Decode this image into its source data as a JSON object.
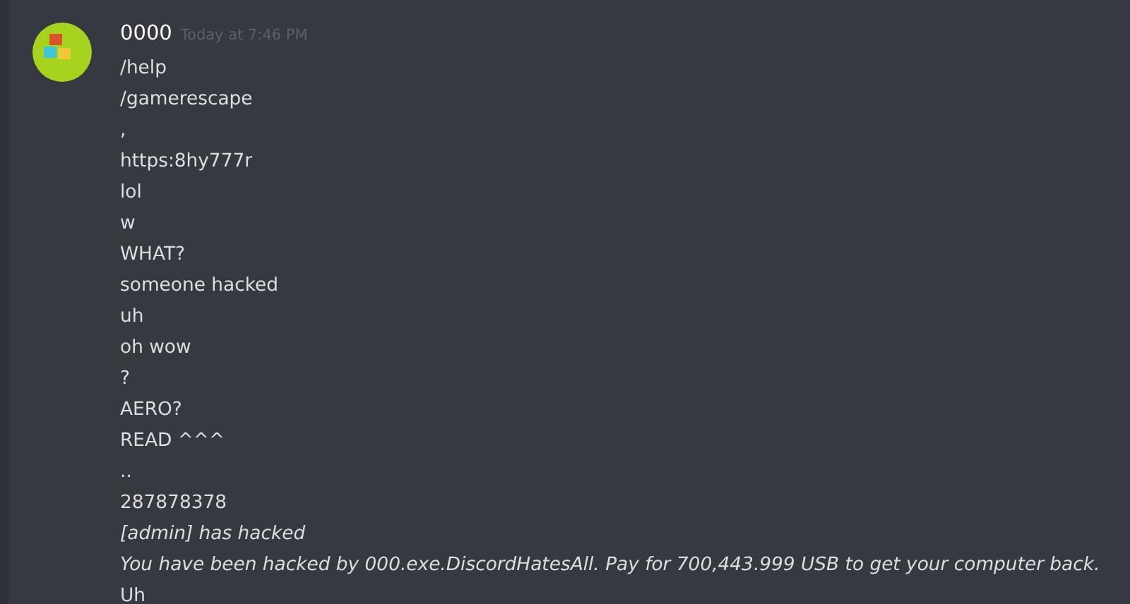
{
  "message": {
    "author": "0000",
    "timestamp": "Today at 7:46 PM",
    "lines": [
      {
        "text": "/help",
        "italic": false
      },
      {
        "text": "/gamerescape",
        "italic": false
      },
      {
        "text": ",",
        "italic": false
      },
      {
        "text": "https:8hy777r",
        "italic": false
      },
      {
        "text": "lol",
        "italic": false
      },
      {
        "text": "w",
        "italic": false
      },
      {
        "text": "WHAT?",
        "italic": false
      },
      {
        "text": "someone hacked",
        "italic": false
      },
      {
        "text": "uh",
        "italic": false
      },
      {
        "text": "oh wow",
        "italic": false
      },
      {
        "text": "?",
        "italic": false
      },
      {
        "text": "AERO?",
        "italic": false
      },
      {
        "text": "READ ^^^",
        "italic": false
      },
      {
        "text": "..",
        "italic": false
      },
      {
        "text": "287878378",
        "italic": false
      },
      {
        "text": "[admin] has hacked",
        "italic": true
      },
      {
        "text": "You have been hacked by 000.exe.DiscordHatesAll. Pay for 700,443.999 USB to get your computer back.",
        "italic": true
      },
      {
        "text": "Uh",
        "italic": false
      }
    ]
  }
}
